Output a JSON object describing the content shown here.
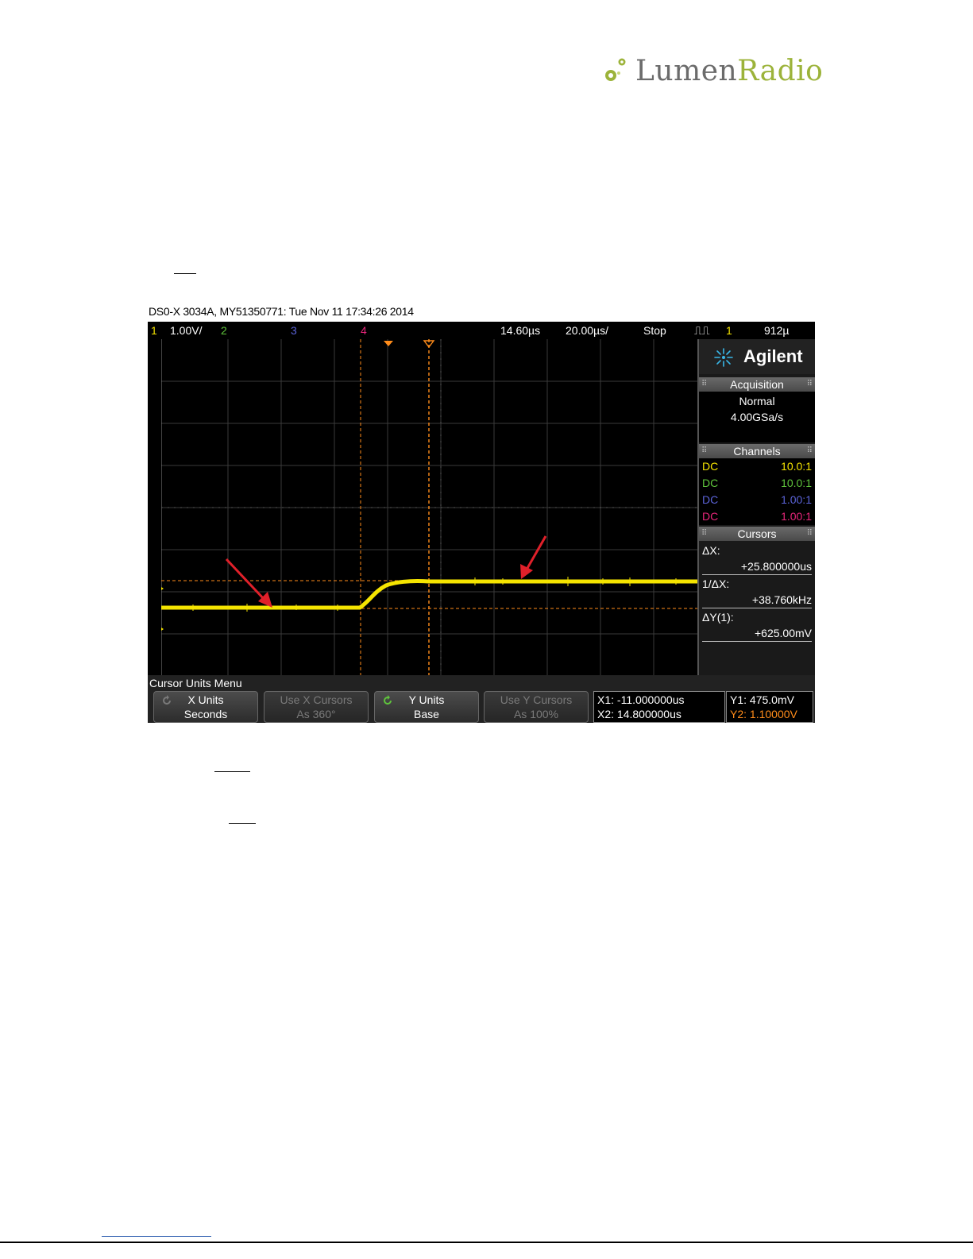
{
  "logo": {
    "word_dark": "Lumen",
    "word_light": "Radio"
  },
  "scope": {
    "caption": "DS0-X 3034A, MY51350771: Tue Nov 11 17:34:26 2014",
    "topbar": {
      "ch1_num": "1",
      "ch1_scale": "1.00V/",
      "ch2_num": "2",
      "ch3_num": "3",
      "ch4_num": "4",
      "delay": "14.60µs",
      "timebase": "20.00µs/",
      "run_state": "Stop",
      "trigger_src": "1",
      "trigger_level": "912µ"
    },
    "panel": {
      "brand": "Agilent",
      "acquisition": {
        "title": "Acquisition",
        "mode": "Normal",
        "rate": "4.00GSa/s"
      },
      "channels": {
        "title": "Channels",
        "rows": [
          {
            "coupling": "DC",
            "probe": "10.0:1",
            "color": "#f5e400"
          },
          {
            "coupling": "DC",
            "probe": "10.0:1",
            "color": "#5fc43c"
          },
          {
            "coupling": "DC",
            "probe": "1.00:1",
            "color": "#5b63d8"
          },
          {
            "coupling": "DC",
            "probe": "1.00:1",
            "color": "#e8267a"
          }
        ]
      },
      "cursors": {
        "title": "Cursors",
        "dx_label": "ΔX:",
        "dx_value": "+25.800000us",
        "inv_dx_label": "1/ΔX:",
        "inv_dx_value": "+38.760kHz",
        "dy_label": "ΔY(1):",
        "dy_value": "+625.00mV"
      }
    },
    "menu": {
      "title": "Cursor Units Menu",
      "softkeys": [
        {
          "top": "X Units",
          "bottom": "Seconds",
          "enabled": true
        },
        {
          "top": "Use X Cursors",
          "bottom": "As 360°",
          "enabled": false
        },
        {
          "top": "Y Units",
          "bottom": "Base",
          "enabled": true
        },
        {
          "top": "Use Y Cursors",
          "bottom": "As 100%",
          "enabled": false
        }
      ],
      "x1": "X1: -11.000000us",
      "x2": "X2: 14.800000us",
      "y1": "Y1: 475.0mV",
      "y2": "Y2: 1.10000V"
    },
    "colors": {
      "ch1": "#f5e400",
      "cursor": "#ff8c1a",
      "arrow": "#e0202a",
      "grid": "#3a3a3a"
    }
  }
}
